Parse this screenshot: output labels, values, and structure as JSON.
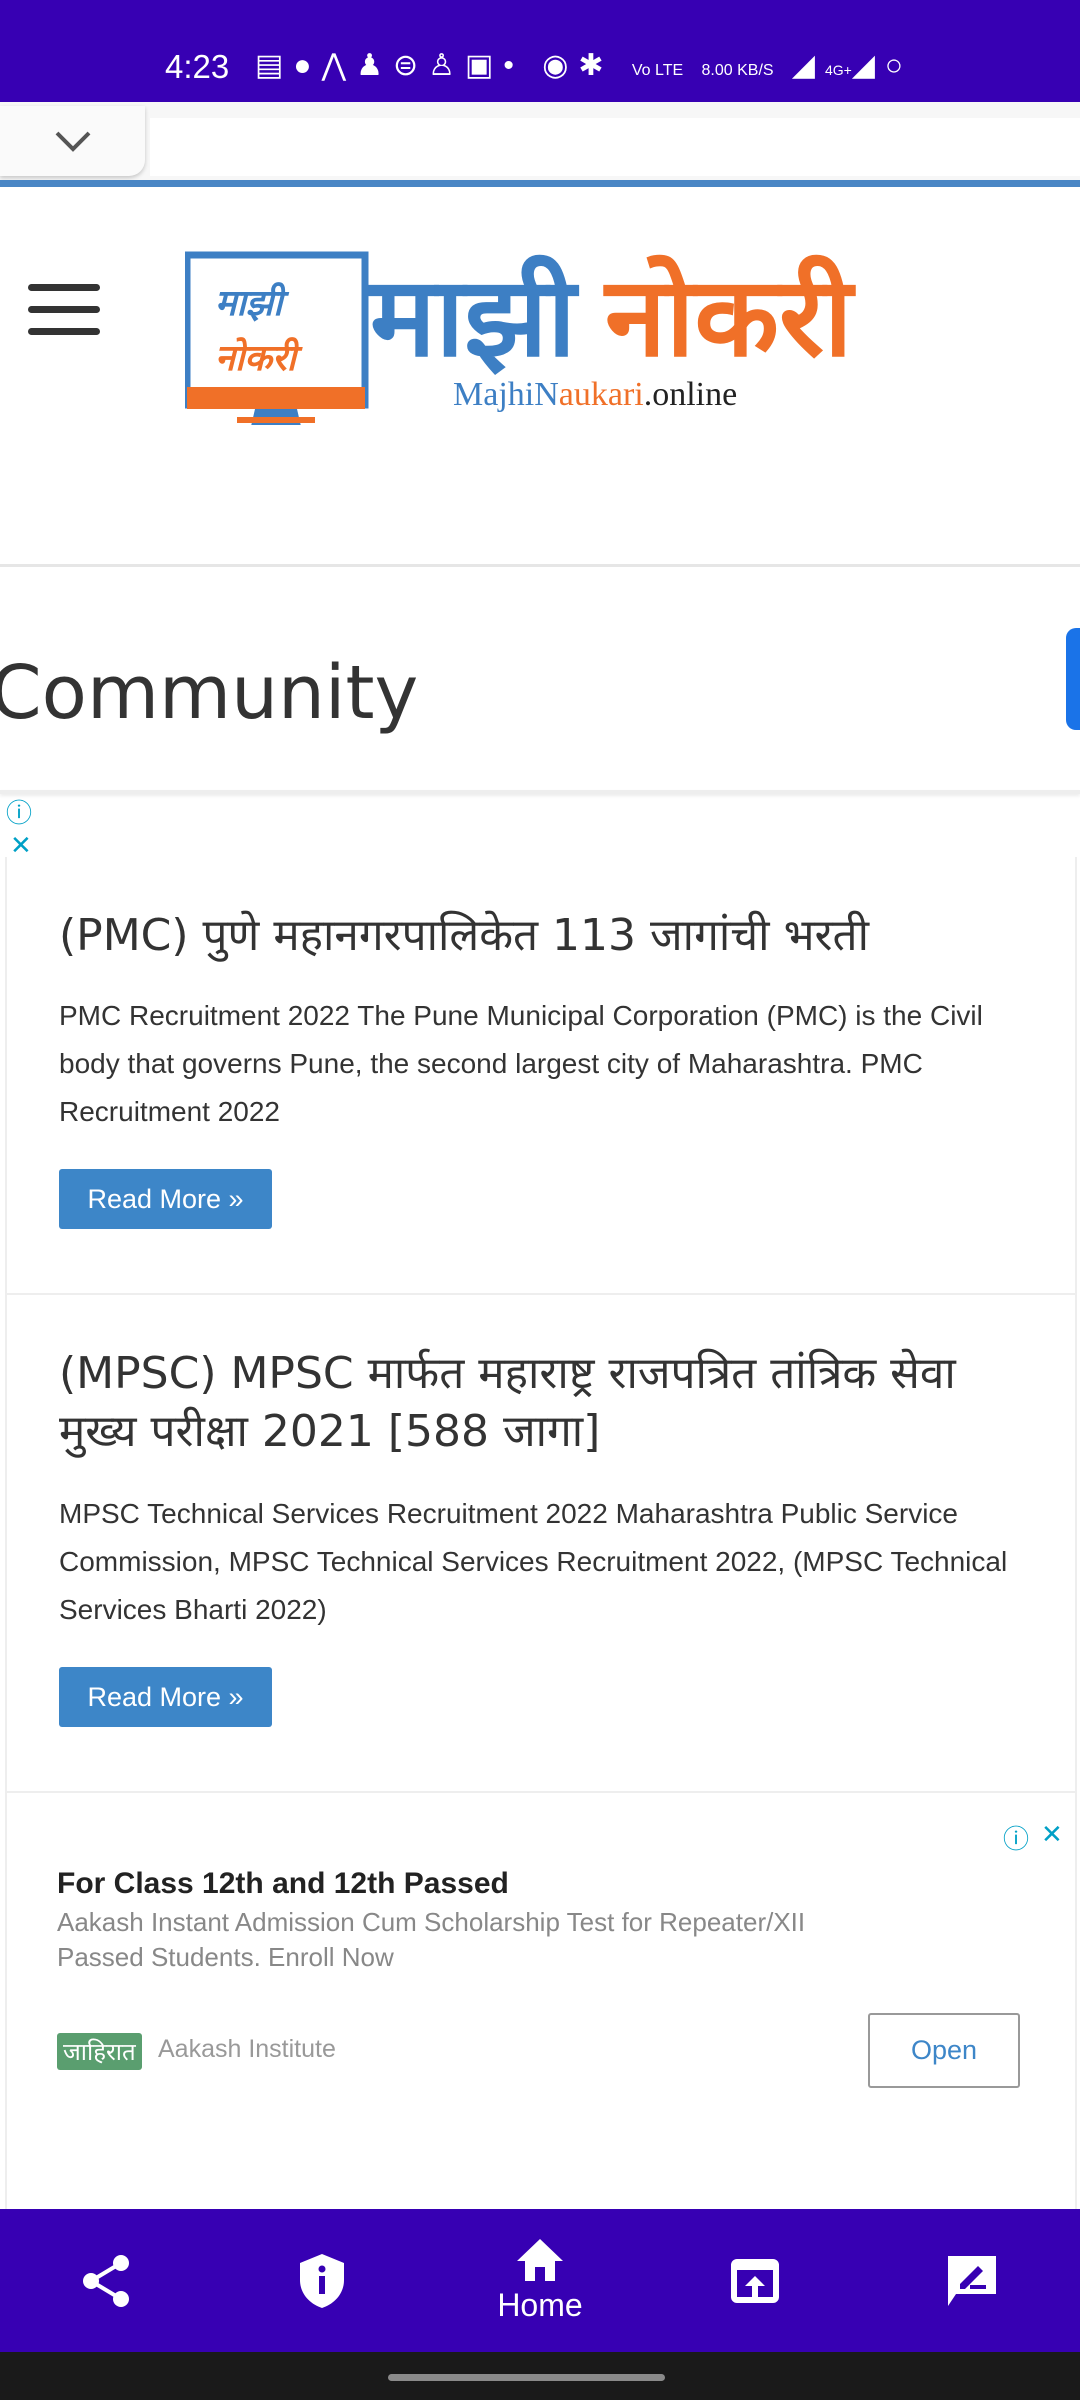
{
  "status_bar": {
    "time": "4:23",
    "icons": [
      "news-icon",
      "chat-icon",
      "app-icon",
      "bottle-icon",
      "app-icon",
      "snapchat-icon",
      "app-icon",
      "dot-icon",
      "hotspot-icon",
      "bluetooth-icon",
      "volte-icon",
      "signal-icon",
      "battery-icon"
    ],
    "net_speed": "8.00 KB/S",
    "network": "4G+",
    "volte": "Vo LTE"
  },
  "header": {
    "logo_text_marathi": "माझी नोकरी",
    "logo_domain": "MajhiNaukari.online",
    "colors": {
      "blue": "#3d7fc4",
      "orange": "#f07028"
    }
  },
  "section": {
    "title": "Community"
  },
  "posts": [
    {
      "title": "(PMC) पुणे महानगरपालिकेत 113 जागांची भरती",
      "excerpt": "PMC Recruitment 2022 The Pune Municipal Corporation (PMC) is the Civil body that governs Pune, the second largest city of Maharashtra. PMC Recruitment 2022",
      "button": "Read More »"
    },
    {
      "title": "(MPSC) MPSC मार्फत महाराष्ट्र राजपत्रित तांत्रिक सेवा मुख्य परीक्षा 2021 [588 जागा]",
      "excerpt": "MPSC Technical Services Recruitment 2022 Maharashtra Public Service Commission, MPSC Technical Services Recruitment 2022, (MPSC Technical Services Bharti 2022)",
      "button": "Read More »"
    }
  ],
  "ad": {
    "title": "For Class 12th and 12th Passed",
    "description": "Aakash Instant Admission Cum Scholarship Test for Repeater/XII Passed Students. Enroll Now",
    "badge": "जाहिरात",
    "advertiser": "Aakash Institute",
    "cta": "Open"
  },
  "bottom_nav": {
    "items": [
      {
        "icon": "share-icon"
      },
      {
        "icon": "shield-info-icon"
      },
      {
        "icon": "home-icon",
        "label": "Home",
        "active": true
      },
      {
        "icon": "open-external-icon"
      },
      {
        "icon": "feedback-icon"
      }
    ]
  },
  "colors": {
    "primary": "#3700b3",
    "button": "#3d86c8"
  }
}
